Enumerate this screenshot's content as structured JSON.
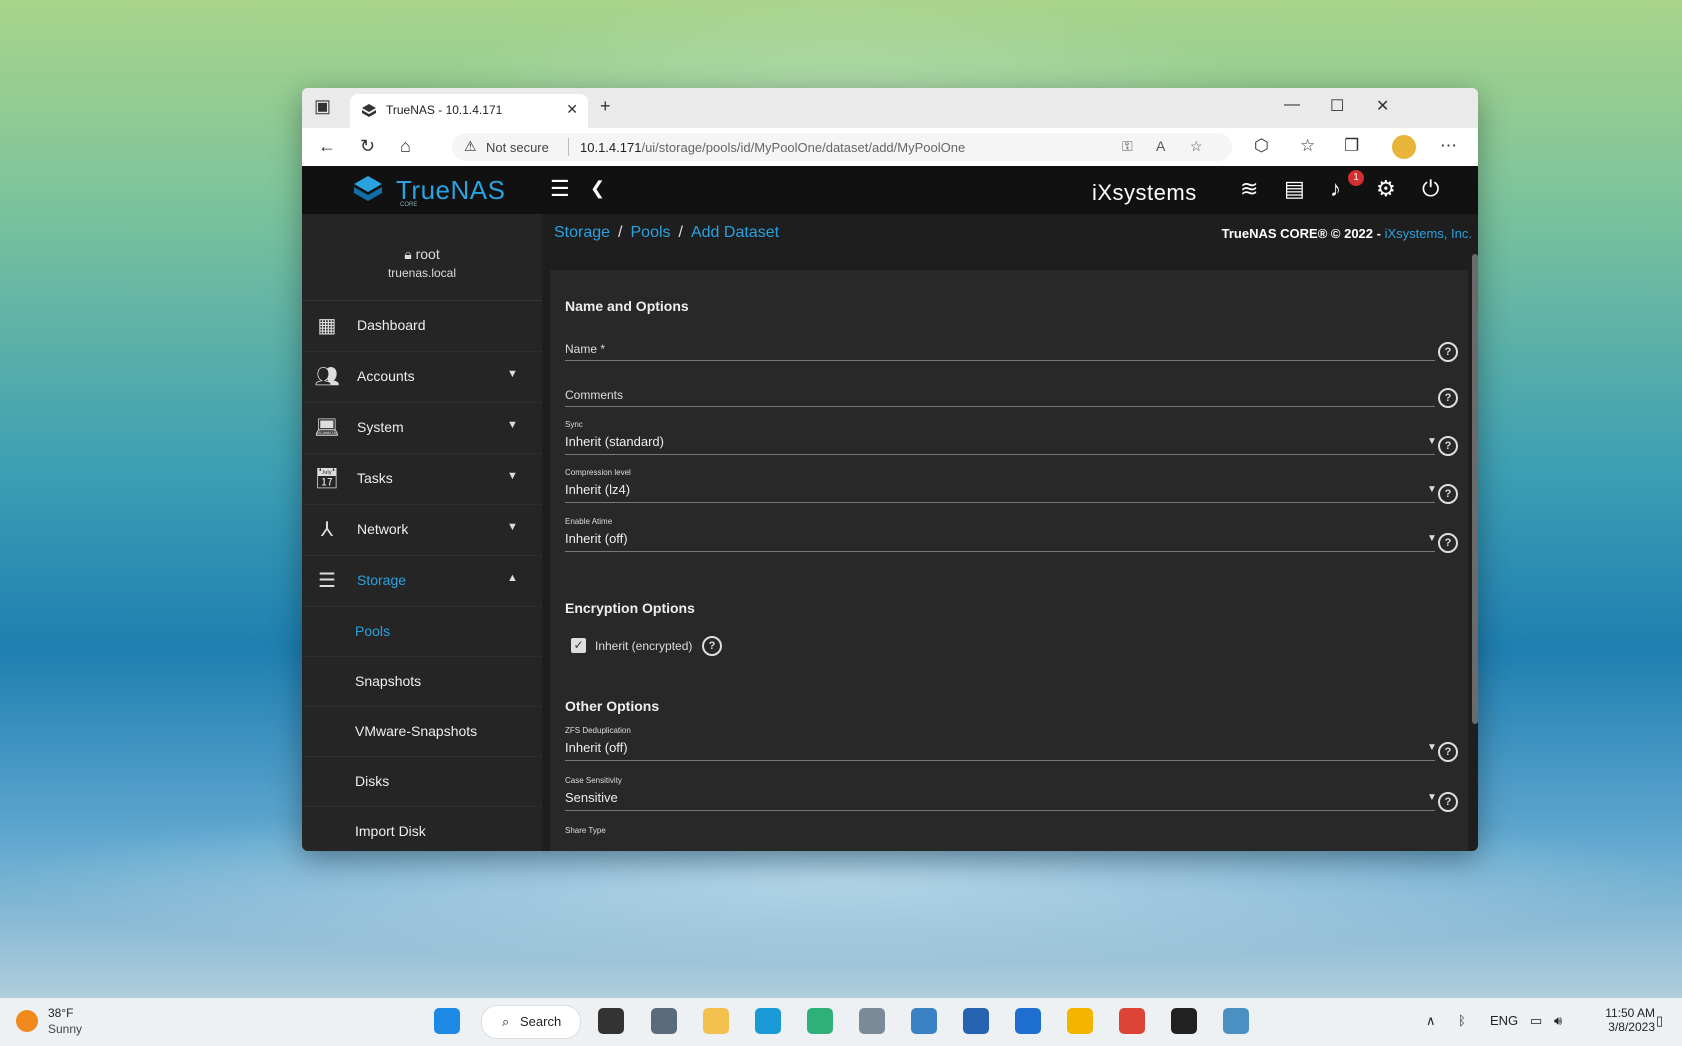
{
  "browser": {
    "tab_title": "TrueNAS - 10.1.4.171",
    "not_secure": "Not secure",
    "url_host": "10.1.4.171",
    "url_path": "/ui/storage/pools/id/MyPoolOne/dataset/add/MyPoolOne"
  },
  "app": {
    "brand": "TrueNAS",
    "brand_sub": "CORE",
    "vendor_logo": "iXsystems",
    "notification_count": "1",
    "accent": "#2aa2df"
  },
  "user": {
    "name": "root",
    "host": "truenas.local"
  },
  "sidebar": {
    "items": [
      {
        "label": "Dashboard",
        "icon": "dashboard-icon"
      },
      {
        "label": "Accounts",
        "icon": "people-icon"
      },
      {
        "label": "System",
        "icon": "laptop-icon"
      },
      {
        "label": "Tasks",
        "icon": "calendar-icon"
      },
      {
        "label": "Network",
        "icon": "network-icon"
      },
      {
        "label": "Storage",
        "icon": "storage-icon"
      }
    ],
    "storage_sub": [
      "Pools",
      "Snapshots",
      "VMware-Snapshots",
      "Disks",
      "Import Disk"
    ]
  },
  "breadcrumb": [
    "Storage",
    "Pools",
    "Add Dataset"
  ],
  "copyright": "TrueNAS CORE® © 2022 - ",
  "copyright_link": "iXsystems, Inc.",
  "form": {
    "section_name": "Name and Options",
    "name_label": "Name *",
    "comments_label": "Comments",
    "sync_label": "Sync",
    "sync_value": "Inherit (standard)",
    "compression_label": "Compression level",
    "compression_value": "Inherit (lz4)",
    "atime_label": "Enable Atime",
    "atime_value": "Inherit (off)",
    "section_encryption": "Encryption Options",
    "inherit_encrypted": "Inherit (encrypted)",
    "inherit_encrypted_checked": true,
    "section_other": "Other Options",
    "dedup_label": "ZFS Deduplication",
    "dedup_value": "Inherit (off)",
    "case_label": "Case Sensitivity",
    "case_value": "Sensitive",
    "share_label": "Share Type"
  },
  "taskbar": {
    "weather_temp": "38°F",
    "weather_desc": "Sunny",
    "search": "Search",
    "lang": "ENG",
    "time": "11:50 AM",
    "date": "3/8/2023"
  }
}
